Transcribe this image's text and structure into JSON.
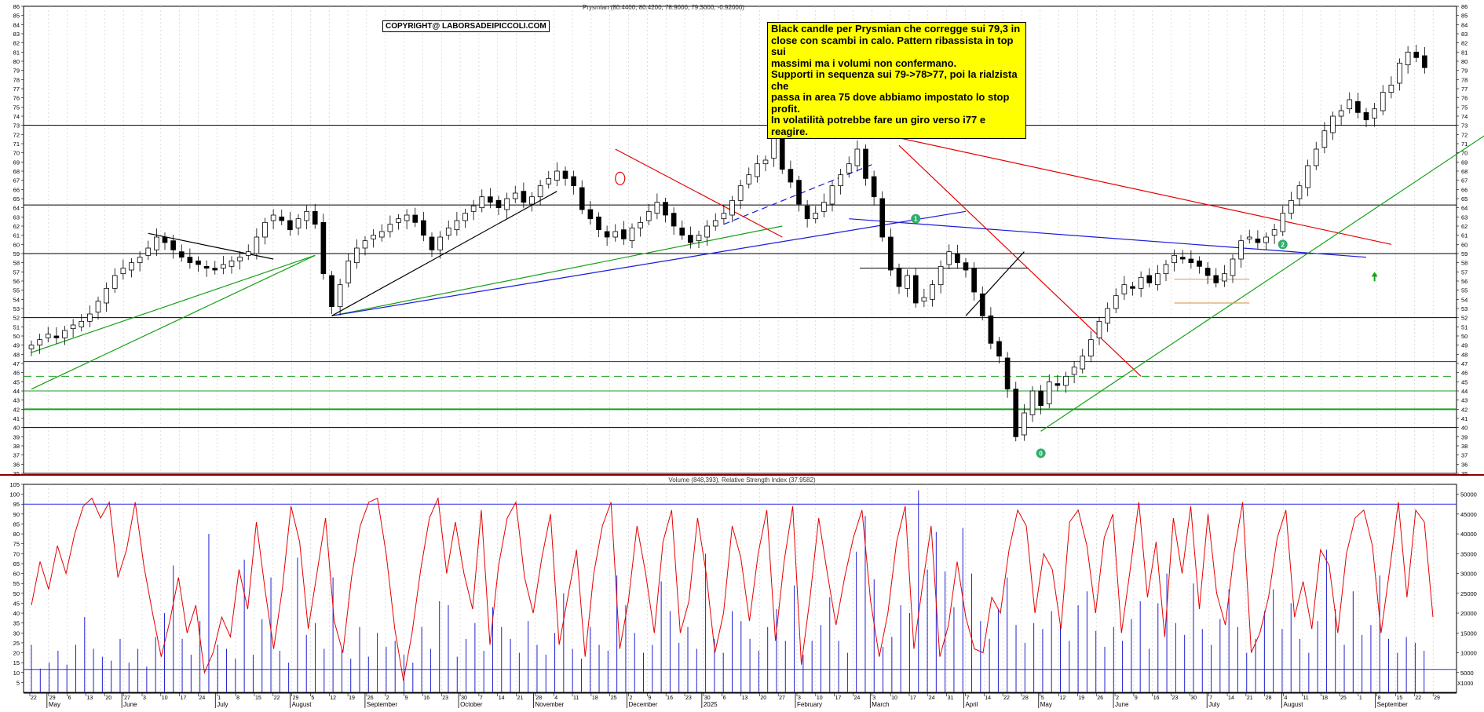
{
  "chart_data": [
    {
      "type": "candlestick",
      "panel": "price",
      "header": "Prysmian (80.4400, 80.4200, 78.9000, 79.3000, -0.92000)",
      "ylim": [
        35,
        86
      ],
      "y_ticks": [
        35,
        36,
        37,
        38,
        39,
        40,
        41,
        42,
        43,
        44,
        45,
        46,
        47,
        48,
        49,
        50,
        51,
        52,
        53,
        54,
        55,
        56,
        57,
        58,
        59,
        60,
        61,
        62,
        63,
        64,
        65,
        66,
        67,
        68,
        69,
        70,
        71,
        72,
        73,
        74,
        75,
        76,
        77,
        78,
        79,
        80,
        81,
        82,
        83,
        84,
        85,
        86
      ],
      "grid": "vertical dashed",
      "closes": [
        49.0,
        49.6,
        50.2,
        49.8,
        50.6,
        51.2,
        51.6,
        52.4,
        53.8,
        55.2,
        56.6,
        57.4,
        58.0,
        58.6,
        59.6,
        60.8,
        60.2,
        59.4,
        58.6,
        58.0,
        57.8,
        57.4,
        57.2,
        57.8,
        58.2,
        58.6,
        59.2,
        60.8,
        62.4,
        63.2,
        62.6,
        61.6,
        62.8,
        63.6,
        62.2,
        56.8,
        53.2,
        55.6,
        58.2,
        59.6,
        60.4,
        61.0,
        61.4,
        62.2,
        62.8,
        63.2,
        62.4,
        61.0,
        59.4,
        60.8,
        61.8,
        62.6,
        63.4,
        64.2,
        65.2,
        64.6,
        64.0,
        65.0,
        65.6,
        64.6,
        65.2,
        66.4,
        67.2,
        68.0,
        67.2,
        66.4,
        63.8,
        62.8,
        61.6,
        60.8,
        61.4,
        60.6,
        61.8,
        62.4,
        63.6,
        64.6,
        63.2,
        62.0,
        61.0,
        60.2,
        61.0,
        62.0,
        62.6,
        63.4,
        64.8,
        66.4,
        67.6,
        68.8,
        69.2,
        72.0,
        68.2,
        66.8,
        64.4,
        62.8,
        63.4,
        64.6,
        66.4,
        67.6,
        68.8,
        70.4,
        67.2,
        65.2,
        60.8,
        57.2,
        55.4,
        56.6,
        53.6,
        54.2,
        55.6,
        57.6,
        59.2,
        58.0,
        57.2,
        54.8,
        52.2,
        49.2,
        47.8,
        44.2,
        39.0,
        41.6,
        44.0,
        42.4,
        45.0,
        44.6,
        45.6,
        46.6,
        47.8,
        49.6,
        51.6,
        53.0,
        54.4,
        55.6,
        55.2,
        56.4,
        55.8,
        56.8,
        57.8,
        58.8,
        58.4,
        58.0,
        57.6,
        56.6,
        55.8,
        56.8,
        58.4,
        60.4,
        60.8,
        60.2,
        60.8,
        61.6,
        63.4,
        64.8,
        66.4,
        68.6,
        70.4,
        72.4,
        74.0,
        74.6,
        75.8,
        74.4,
        73.6,
        74.8,
        76.6,
        77.4,
        79.8,
        81.0,
        80.4,
        79.3
      ],
      "resistance_support_levels": [
        73,
        64.3,
        59,
        57.4,
        52,
        47.2,
        45.6,
        44,
        42,
        40
      ],
      "badges": [
        "0",
        "1",
        "2"
      ],
      "annotation": [
        "Black candle per Prysmian che corregge sui 79,3 in",
        "close con scambi in calo. Pattern ribassista in top sui",
        "massimi ma i volumi non confermano.",
        "Supporti in sequenza sui 79->78>77, poi la rialzista che",
        "passa in area 75 dove abbiamo impostato lo stop profit.",
        "In volatilità potrebbe fare un giro verso  i77 e reagire."
      ],
      "copyright": "COPYRIGHT@ LABORSADEIPICCOLI.COM"
    },
    {
      "type": "line+bar",
      "panel": "indicator",
      "header": "Volume (848,393), Relative Strength Index (37.9582)",
      "rsi_ylim": [
        0,
        105
      ],
      "rsi_ticks": [
        5,
        10,
        15,
        20,
        25,
        30,
        35,
        40,
        45,
        50,
        55,
        60,
        65,
        70,
        75,
        80,
        85,
        90,
        95,
        100,
        105
      ],
      "volume_ylim": [
        0,
        52500
      ],
      "volume_ticks": [
        "5000",
        "10000",
        "15000",
        "20000",
        "25000",
        "30000",
        "35000",
        "40000",
        "45000",
        "50000"
      ],
      "volume_unit": "X1000",
      "rsi_reference": 95,
      "volume_reference": 5800,
      "rsi_values": [
        44,
        66,
        52,
        74,
        60,
        80,
        94,
        98,
        88,
        96,
        58,
        72,
        96,
        64,
        40,
        18,
        36,
        58,
        30,
        44,
        10,
        20,
        38,
        28,
        62,
        42,
        86,
        52,
        22,
        52,
        94,
        76,
        32,
        60,
        88,
        36,
        20,
        58,
        84,
        96,
        98,
        70,
        32,
        6,
        30,
        62,
        88,
        98,
        60,
        86,
        60,
        42,
        92,
        24,
        64,
        88,
        96,
        58,
        40,
        68,
        90,
        24,
        48,
        72,
        18,
        60,
        84,
        96,
        22,
        46,
        84,
        60,
        30,
        76,
        92,
        30,
        46,
        88,
        60,
        20,
        40,
        84,
        68,
        36,
        70,
        92,
        26,
        66,
        94,
        14,
        48,
        88,
        60,
        34,
        58,
        78,
        92,
        46,
        18,
        40,
        76,
        94,
        22,
        54,
        84,
        18,
        34,
        66,
        38,
        22,
        20,
        48,
        40,
        72,
        92,
        84,
        40,
        70,
        62,
        32,
        86,
        92,
        74,
        40,
        78,
        90,
        30,
        62,
        96,
        48,
        76,
        28,
        88,
        60,
        94,
        42,
        90,
        50,
        34,
        70,
        96,
        20,
        30,
        48,
        78,
        92,
        38,
        56,
        32,
        72,
        64,
        30,
        70,
        88,
        92,
        74,
        30,
        62,
        96,
        48,
        92,
        86,
        38
      ],
      "volume_values": [
        12000,
        6000,
        7500,
        10500,
        7000,
        12000,
        19000,
        11000,
        9000,
        8000,
        13500,
        7500,
        11000,
        6500,
        14000,
        20000,
        32000,
        13500,
        9500,
        18000,
        40000,
        12000,
        11000,
        8500,
        33500,
        9500,
        18500,
        29000,
        10500,
        7500,
        34000,
        14500,
        17500,
        11000,
        29000,
        11000,
        8500,
        16500,
        9000,
        15000,
        11500,
        13000,
        9500,
        7500,
        16500,
        11000,
        23000,
        22000,
        9000,
        13500,
        17500,
        10500,
        21500,
        16500,
        13500,
        10000,
        18000,
        12000,
        9500,
        15000,
        25000,
        11000,
        8500,
        16500,
        12000,
        10500,
        29500,
        22000,
        15000,
        10000,
        12000,
        28000,
        20500,
        12500,
        16500,
        11000,
        35000,
        13500,
        10000,
        20500,
        18000,
        13500,
        10500,
        16500,
        21000,
        13000,
        27000,
        9500,
        13000,
        17000,
        24000,
        13000,
        10000,
        35500,
        44500,
        28500,
        11500,
        14000,
        22000,
        20000,
        51000,
        31000,
        40500,
        30500,
        21500,
        41500,
        30000,
        18000,
        13500,
        21000,
        29000,
        17000,
        12500,
        17500,
        16000,
        20500,
        17000,
        13000,
        22000,
        25500,
        15500,
        11500,
        16500,
        13000,
        18500,
        23000,
        11000,
        22500,
        30000,
        17500,
        14500,
        27500,
        16000,
        12000,
        18500,
        26000,
        16500,
        10000,
        13500,
        20500,
        26000,
        16000,
        22500,
        13500,
        10000,
        18000,
        36000,
        21000,
        12000,
        25500,
        14500,
        17000,
        29500,
        13500,
        10000,
        14000,
        12500,
        10500
      ]
    }
  ],
  "x_axis": {
    "month_labels": [
      "May",
      "June",
      "July",
      "August",
      "September",
      "October",
      "November",
      "December",
      "2025",
      "February",
      "March",
      "April",
      "May",
      "June",
      "July",
      "August",
      "September"
    ],
    "day_labels": [
      "22",
      "29",
      "6",
      "13",
      "20",
      "27",
      "3",
      "10",
      "17",
      "24",
      "1",
      "8",
      "15",
      "22",
      "29",
      "5",
      "12",
      "19",
      "26",
      "2",
      "9",
      "16",
      "23",
      "30",
      "7",
      "14",
      "21",
      "28",
      "4",
      "11",
      "18",
      "25",
      "2",
      "9",
      "16",
      "23",
      "30",
      "6",
      "13",
      "20",
      "27",
      "3",
      "10",
      "17",
      "24",
      "3",
      "10",
      "17",
      "24",
      "31",
      "7",
      "14",
      "22",
      "28",
      "5",
      "12",
      "19",
      "26",
      "2",
      "9",
      "16",
      "23",
      "30",
      "7",
      "14",
      "21",
      "28",
      "4",
      "11",
      "18",
      "25",
      "1",
      "8",
      "15",
      "22",
      "29"
    ]
  },
  "colors": {
    "candle": "#000000",
    "trend_red": "#e60000",
    "trend_blue": "#1a1adb",
    "trend_green": "#16a016",
    "level_black": "#000000",
    "level_blue": "#1a1adb",
    "level_green": "#1f9d1f",
    "rsi_line": "#e60000",
    "volume_bar": "#2020d0",
    "reference_line": "#3030e0",
    "badge_bg": "#2fae6a",
    "annotation_bg": "#ffff00"
  }
}
